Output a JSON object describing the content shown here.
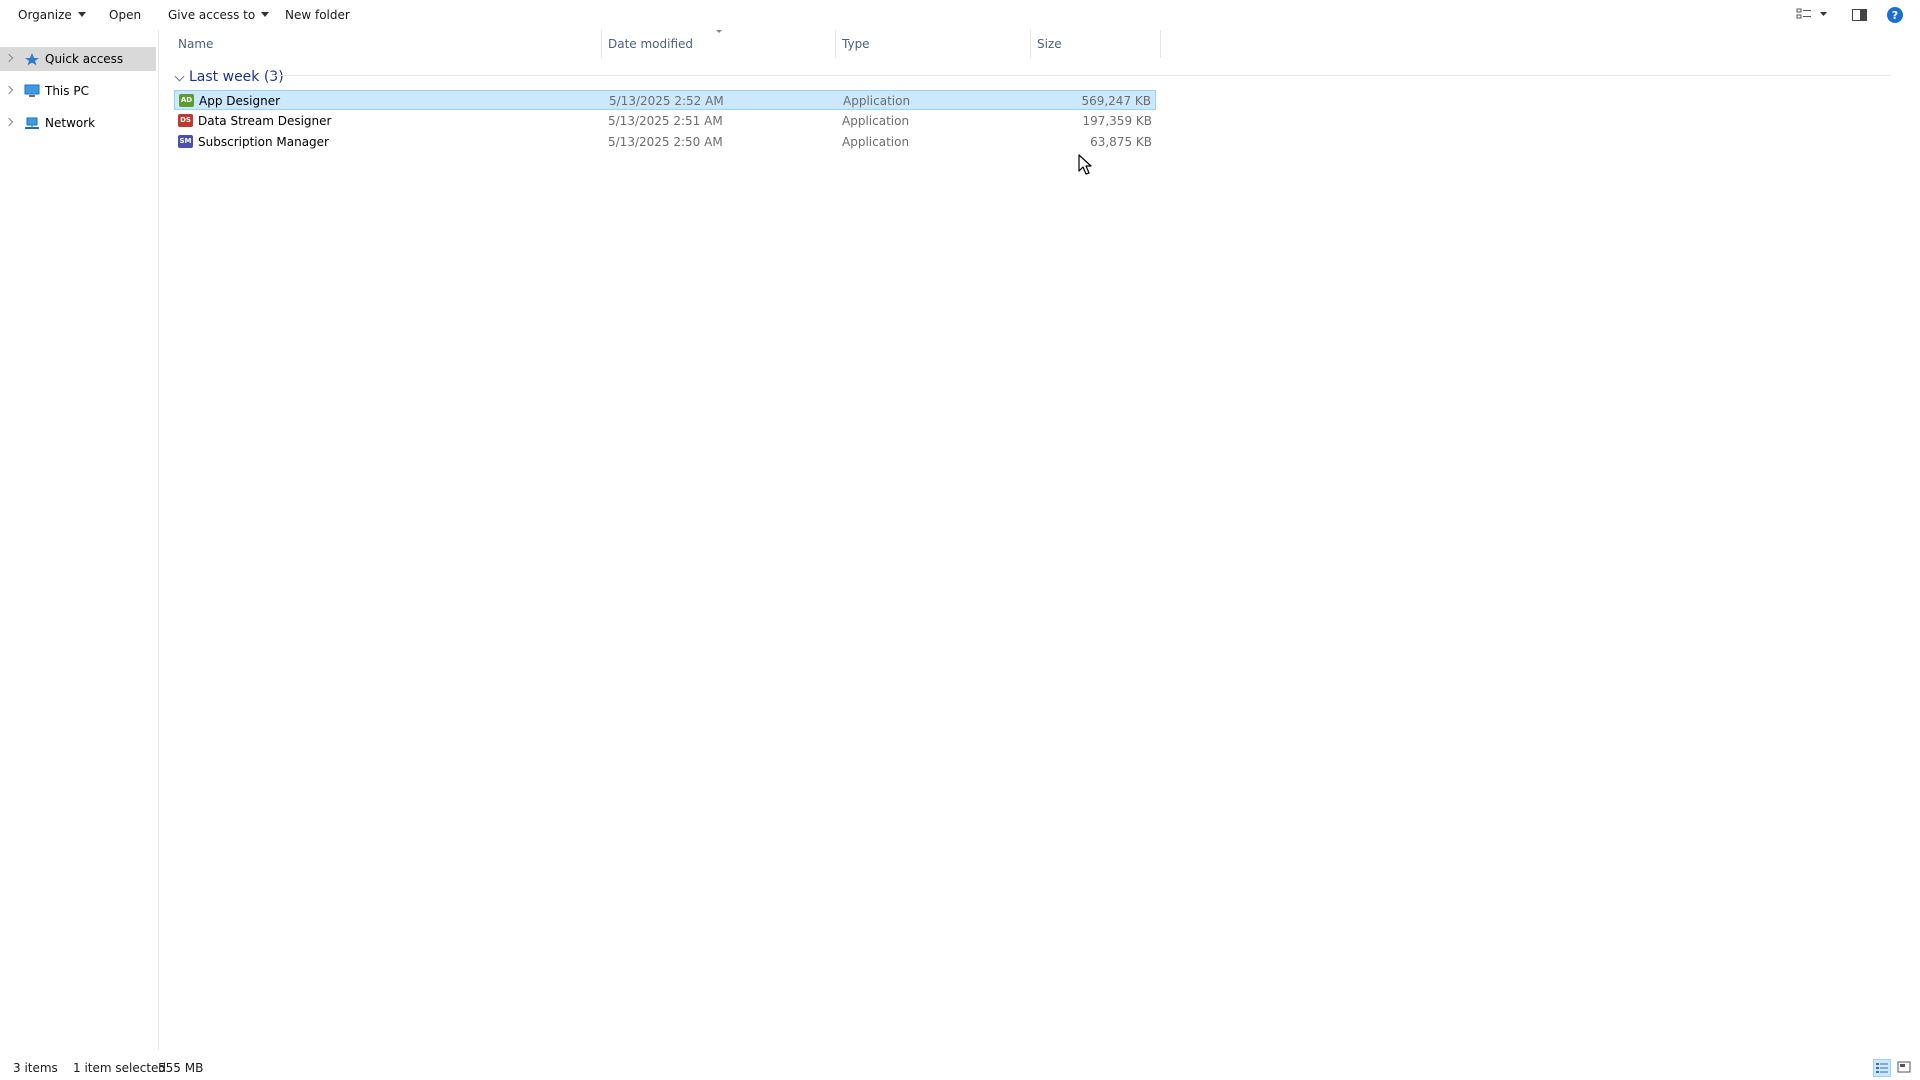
{
  "toolbar": {
    "organize": "Organize",
    "open": "Open",
    "give_access": "Give access to",
    "new_folder": "New folder"
  },
  "nav": {
    "items": [
      {
        "label": "Quick access",
        "icon": "star-pin-icon",
        "selected": true
      },
      {
        "label": "This PC",
        "icon": "computer-icon",
        "selected": false
      },
      {
        "label": "Network",
        "icon": "network-icon",
        "selected": false
      }
    ]
  },
  "columns": {
    "name": "Name",
    "date": "Date modified",
    "type": "Type",
    "size": "Size"
  },
  "group": {
    "label": "Last week (3)"
  },
  "files": [
    {
      "icon": "AD",
      "name": "App Designer",
      "date": "5/13/2025 2:52 AM",
      "type": "Application",
      "size": "569,247 KB",
      "selected": true,
      "color": "#5a9e2f"
    },
    {
      "icon": "DS",
      "name": "Data Stream Designer",
      "date": "5/13/2025 2:51 AM",
      "type": "Application",
      "size": "197,359 KB",
      "selected": false,
      "color": "#c0392b"
    },
    {
      "icon": "SM",
      "name": "Subscription Manager",
      "date": "5/13/2025 2:50 AM",
      "type": "Application",
      "size": "63,875 KB",
      "selected": false,
      "color": "#4a4fb0"
    }
  ],
  "status": {
    "item_count": "3 items",
    "selection": "1 item selected",
    "selection_size": "555 MB"
  },
  "colors": {
    "selection_bg": "#cce8ff",
    "selection_border": "#99d1ff",
    "group_header": "#1e3287",
    "help_blue": "#1a6fd4"
  }
}
